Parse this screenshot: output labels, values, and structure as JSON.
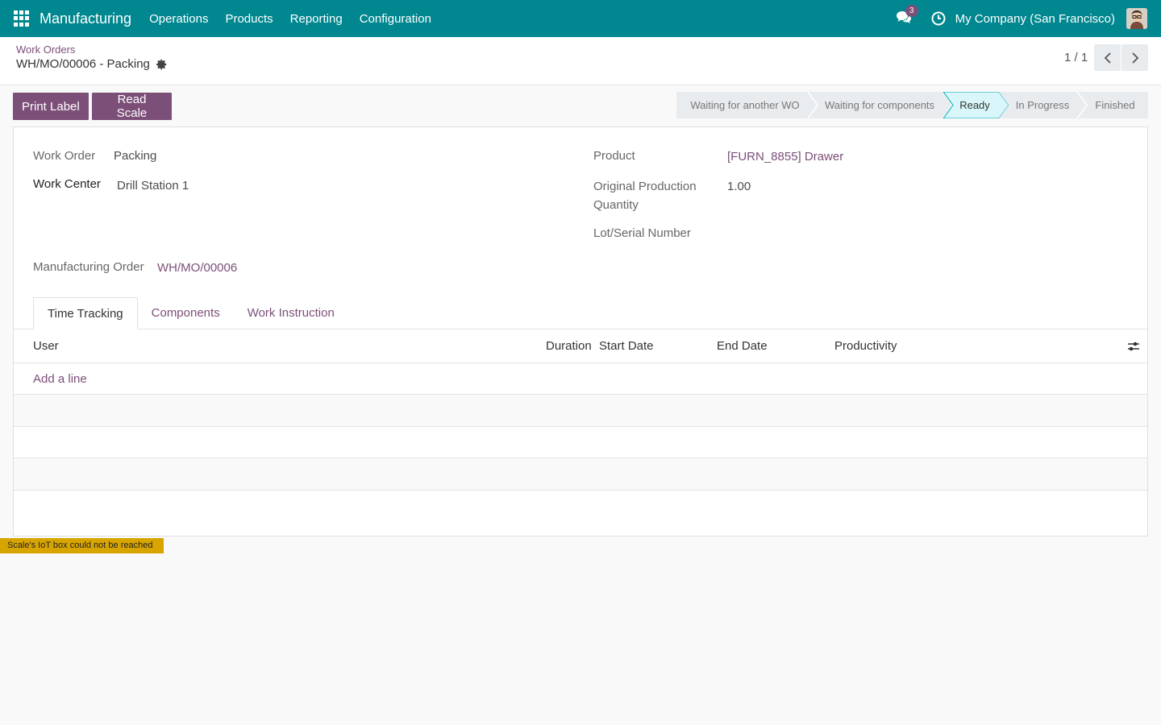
{
  "navbar": {
    "brand": "Manufacturing",
    "menu": [
      "Operations",
      "Products",
      "Reporting",
      "Configuration"
    ],
    "chat_count": "3",
    "company": "My Company (San Francisco)",
    "color": "#00878f"
  },
  "control_panel": {
    "breadcrumb": "Work Orders",
    "title": "WH/MO/00006 - Packing",
    "pager": "1 / 1"
  },
  "actions": {
    "print_label": "Print Label",
    "read_scale": "Read Scale"
  },
  "status_stages": [
    {
      "label": "Waiting for another WO",
      "active": false
    },
    {
      "label": "Waiting for components",
      "active": false
    },
    {
      "label": "Ready",
      "active": true
    },
    {
      "label": "In Progress",
      "active": false
    },
    {
      "label": "Finished",
      "active": false
    }
  ],
  "form": {
    "work_order_label": "Work Order",
    "work_order_value": "Packing",
    "work_center_label": "Work Center",
    "work_center_value": "Drill Station 1",
    "manufacturing_order_label": "Manufacturing Order",
    "manufacturing_order_value": "WH/MO/00006",
    "product_label": "Product",
    "product_value": "[FURN_8855] Drawer",
    "original_qty_label_line1": "Original Production",
    "original_qty_label_line2": "Quantity",
    "original_qty_value": "1.00",
    "lot_label": "Lot/Serial Number"
  },
  "tabs": [
    "Time Tracking",
    "Components",
    "Work Instruction"
  ],
  "table": {
    "columns": [
      "User",
      "Duration",
      "Start Date",
      "End Date",
      "Productivity"
    ],
    "add_line": "Add a line"
  },
  "notification": "Scale's IoT box could not be reached",
  "colors": {
    "primary": "#7c4f79",
    "navbar": "#00878f",
    "active_stage": "#d9f7fa",
    "warning": "#d8a500"
  }
}
